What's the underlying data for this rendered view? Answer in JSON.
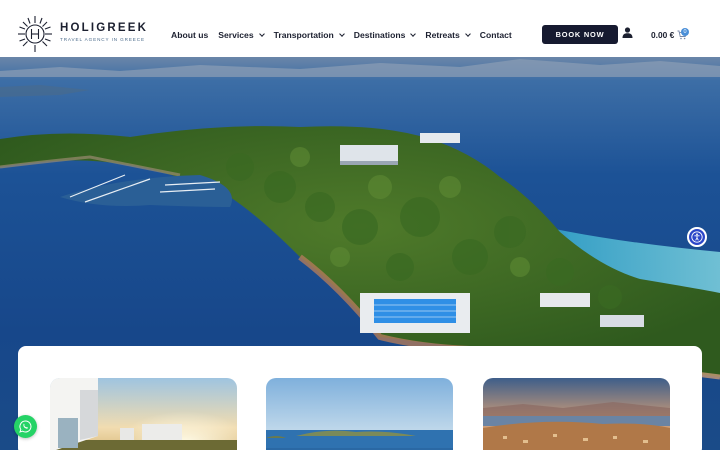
{
  "brand": {
    "name": "HOLIGREEK",
    "tagline": "TRAVEL AGENCY IN GREECE",
    "colors": {
      "navy": "#161a30",
      "accent": "#4a8fd8",
      "accessibility": "#2c46c8",
      "whatsapp": "#25d366"
    }
  },
  "nav": {
    "items": [
      {
        "label": "About us",
        "dropdown": false
      },
      {
        "label": "Services",
        "dropdown": true
      },
      {
        "label": "Transportation",
        "dropdown": true
      },
      {
        "label": "Destinations",
        "dropdown": true
      },
      {
        "label": "Retreats",
        "dropdown": true
      },
      {
        "label": "Contact",
        "dropdown": false
      }
    ]
  },
  "header": {
    "book_label": "BOOK NOW",
    "cart_total": "0.00 €",
    "cart_count": "0",
    "icons": [
      "user-icon",
      "cart-icon"
    ]
  },
  "hero": {
    "image": "aerial-view-peninsula-icon",
    "floating_icons": [
      "accessibility-icon",
      "whatsapp-icon"
    ]
  },
  "cards": [
    {
      "image": "villa-sunset-thumbnail"
    },
    {
      "image": "sea-coast-thumbnail"
    },
    {
      "image": "coastal-town-sunset-thumbnail"
    }
  ]
}
